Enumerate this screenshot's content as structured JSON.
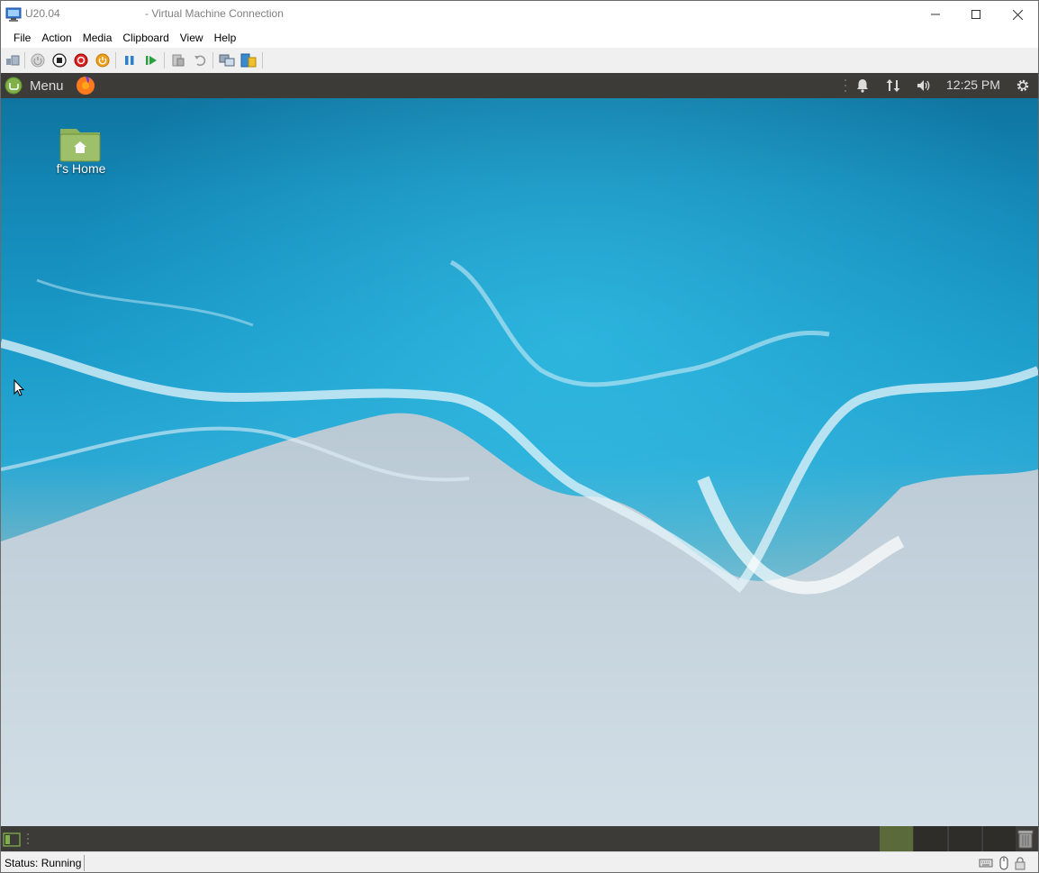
{
  "window": {
    "vm_name": "U20.04",
    "title": "- Virtual Machine Connection"
  },
  "menu": [
    "File",
    "Action",
    "Media",
    "Clipboard",
    "View",
    "Help"
  ],
  "toolbar_icons": [
    "ctrl-alt-del-icon",
    "start-icon",
    "turn-off-icon",
    "shutdown-icon",
    "save-icon",
    "pause-icon",
    "resume-icon",
    "checkpoint-icon",
    "revert-icon",
    "enhanced-session-icon",
    "share-icon"
  ],
  "guest": {
    "menu_label": "Menu",
    "clock": "12:25 PM",
    "desktop_icon_label": "f's Home",
    "colors": {
      "panel": "#3c3b37",
      "active_workspace": "#5a6a3a"
    }
  },
  "status": {
    "text": "Status: Running"
  }
}
